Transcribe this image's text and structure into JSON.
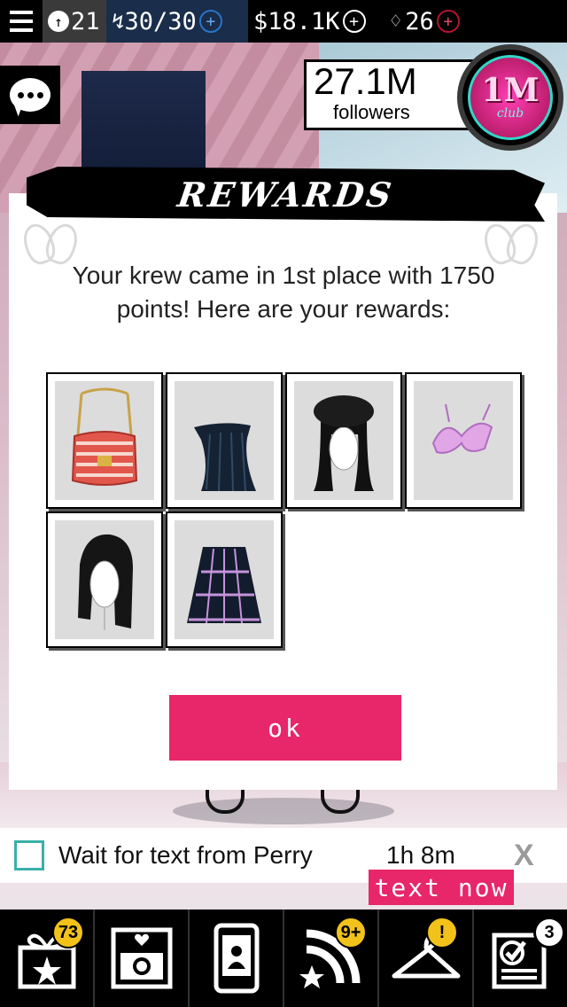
{
  "status_bar": {
    "level": "21",
    "energy": "30/30",
    "cash": "$18.1K",
    "krew_points": "26",
    "plus": "+"
  },
  "followers": {
    "count": "27.1M",
    "label": "followers",
    "badge_big": "1M",
    "badge_small": "club"
  },
  "modal": {
    "title": "REWARDS",
    "message": "Your krew came in 1st place with 1750 points! Here are your rewards:",
    "items": [
      {
        "icon": "handbag-icon"
      },
      {
        "icon": "strapless-dress-icon"
      },
      {
        "icon": "beret-hair-icon"
      },
      {
        "icon": "bikini-top-icon"
      },
      {
        "icon": "long-hair-icon"
      },
      {
        "icon": "cage-skirt-icon"
      }
    ],
    "ok_label": "ok"
  },
  "task": {
    "text": "Wait for text from Perry",
    "time": "1h 8m",
    "close": "X",
    "action": "text now"
  },
  "nav": {
    "gifts_badge": "73",
    "feed_badge": "9+",
    "closet_badge": "!",
    "goals_badge": "3",
    "items": [
      "gift-icon",
      "photo-album-icon",
      "phone-icon",
      "feed-icon",
      "hanger-icon",
      "goals-icon"
    ]
  },
  "colors": {
    "accent_pink": "#e8266a",
    "teal": "#3ab0a8",
    "badge_gold": "#f2c21a"
  }
}
